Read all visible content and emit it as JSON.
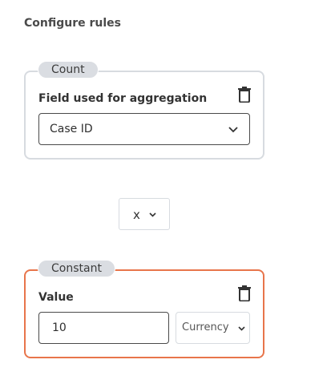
{
  "page": {
    "heading": "Configure rules"
  },
  "count_rule": {
    "tag": "Count",
    "field_label": "Field used for aggregation",
    "field_select": {
      "selected": "Case ID"
    },
    "icons": {
      "delete": "trash-icon",
      "dropdown": "chevron-down-icon"
    }
  },
  "operator": {
    "selected": "x",
    "icon": "chevron-down-icon"
  },
  "constant_rule": {
    "tag": "Constant",
    "value_label": "Value",
    "value_input": {
      "value": "10"
    },
    "unit_select": {
      "selected": "Currency"
    },
    "icons": {
      "delete": "trash-icon",
      "dropdown": "chevron-down-icon"
    }
  },
  "colors": {
    "active_border": "#e8754b",
    "inactive_border": "#d7dbe0",
    "pill_background": "#dadde2"
  }
}
